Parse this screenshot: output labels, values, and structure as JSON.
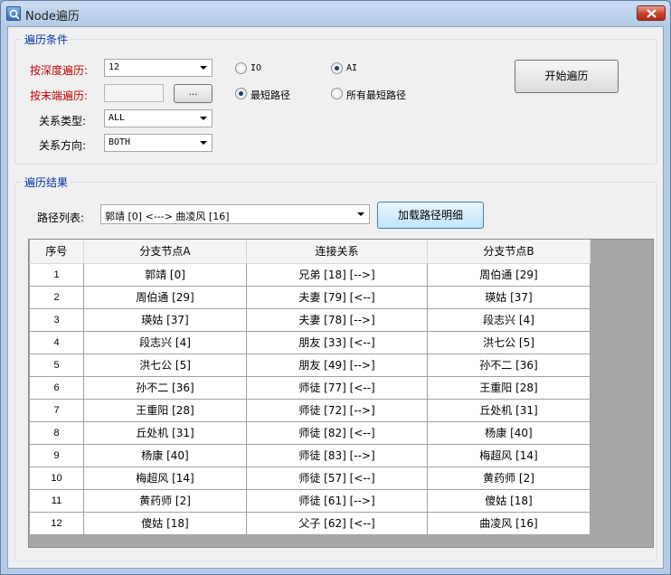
{
  "window": {
    "title": "Node遍历"
  },
  "conditions": {
    "group_title": "遍历条件",
    "depth_label": "按深度遍历:",
    "depth_value": "12",
    "endpoint_label": "按末端遍历:",
    "endpoint_value": "",
    "browse_label": "...",
    "relation_type_label": "关系类型:",
    "relation_type_value": "ALL",
    "relation_dir_label": "关系方向:",
    "relation_dir_value": "BOTH",
    "radio_io": "IO",
    "radio_ai": "AI",
    "radio_shortest": "最短路径",
    "radio_all_shortest": "所有最短路径",
    "start_button": "开始遍历"
  },
  "results": {
    "group_title": "遍历结果",
    "path_list_label": "路径列表:",
    "path_list_value": "郭靖 [0] <---> 曲凌风 [16]",
    "load_button": "加载路径明细",
    "columns": [
      "序号",
      "分支节点A",
      "连接关系",
      "分支节点B"
    ],
    "rows": [
      [
        "1",
        "郭靖 [0]",
        "兄弟 [18] [-->]",
        "周伯通 [29]"
      ],
      [
        "2",
        "周伯通 [29]",
        "夫妻 [79] [<--]",
        "瑛姑 [37]"
      ],
      [
        "3",
        "瑛姑 [37]",
        "夫妻 [78] [-->]",
        "段志兴 [4]"
      ],
      [
        "4",
        "段志兴 [4]",
        "朋友 [33] [<--]",
        "洪七公 [5]"
      ],
      [
        "5",
        "洪七公 [5]",
        "朋友 [49] [-->]",
        "孙不二 [36]"
      ],
      [
        "6",
        "孙不二 [36]",
        "师徒 [77] [<--]",
        "王重阳 [28]"
      ],
      [
        "7",
        "王重阳 [28]",
        "师徒 [72] [-->]",
        "丘处机 [31]"
      ],
      [
        "8",
        "丘处机 [31]",
        "师徒 [82] [<--]",
        "杨康 [40]"
      ],
      [
        "9",
        "杨康 [40]",
        "师徒 [83] [-->]",
        "梅超风 [14]"
      ],
      [
        "10",
        "梅超风 [14]",
        "师徒 [57] [<--]",
        "黄药师 [2]"
      ],
      [
        "11",
        "黄药师 [2]",
        "师徒 [61] [-->]",
        "傻姑 [18]"
      ],
      [
        "12",
        "傻姑 [18]",
        "父子 [62] [<--]",
        "曲凌风 [16]"
      ]
    ]
  }
}
